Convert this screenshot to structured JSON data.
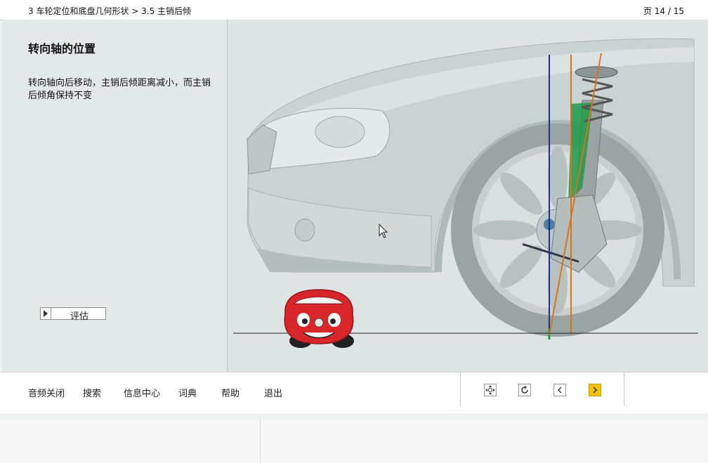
{
  "header": {
    "breadcrumb": "3 车轮定位和底盘几何形状 > 3.5 主销后倾",
    "page_indicator": "页 14 / 15"
  },
  "content": {
    "title": "转向轴的位置",
    "description": "转向轴向后移动，主销后倾距离减小，而主销后倾角保持不变",
    "evaluate_label": "评估"
  },
  "footer": {
    "menu": [
      "音频关闭",
      "搜索",
      "信息中心",
      "词典",
      "帮助",
      "退出"
    ],
    "nav_icons": [
      "move-icon",
      "refresh-icon",
      "previous-icon",
      "next-icon"
    ]
  },
  "colors": {
    "accent": "#f2c200",
    "vertical_axis": "#1a2f8c",
    "caster_axis": "#d9731a",
    "strut_highlight": "#1f9a4a",
    "mascot_red": "#d8262a"
  }
}
